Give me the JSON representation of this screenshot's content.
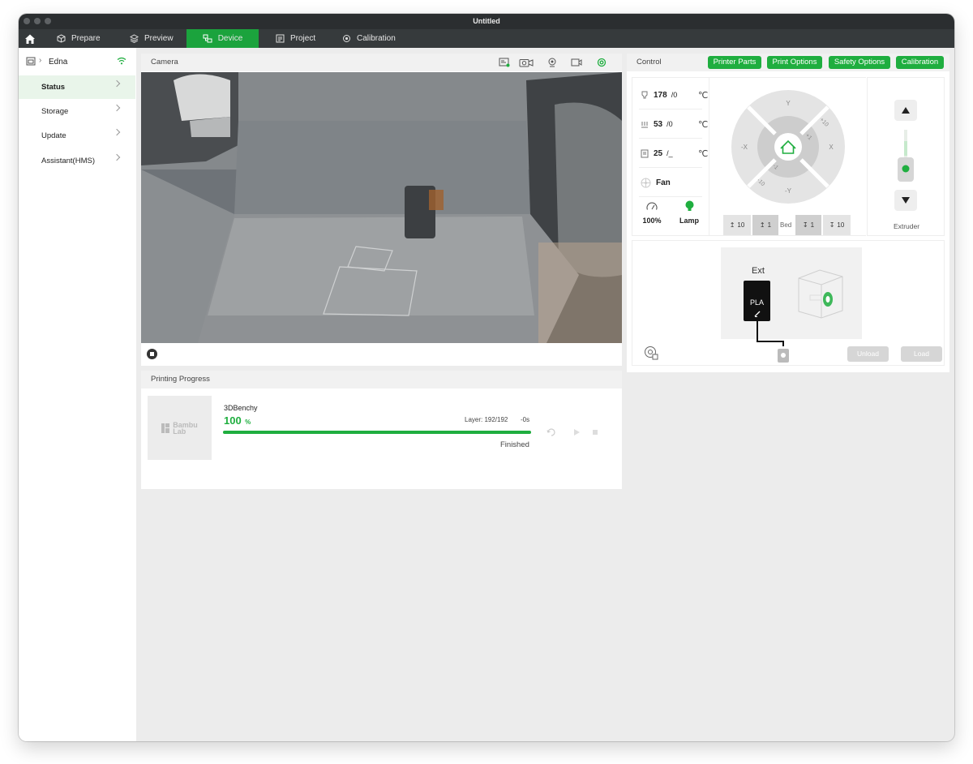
{
  "window": {
    "title": "Untitled"
  },
  "tabs": [
    {
      "label": "Prepare",
      "icon": "cube-icon"
    },
    {
      "label": "Preview",
      "icon": "layers-icon"
    },
    {
      "label": "Device",
      "icon": "device-icon",
      "active": true
    },
    {
      "label": "Project",
      "icon": "project-icon"
    },
    {
      "label": "Calibration",
      "icon": "calibration-icon"
    }
  ],
  "sidebar": {
    "device_name": "Edna",
    "items": [
      {
        "label": "Status",
        "active": true
      },
      {
        "label": "Storage"
      },
      {
        "label": "Update"
      },
      {
        "label": "Assistant(HMS)"
      }
    ]
  },
  "camera": {
    "title": "Camera",
    "icons": [
      "sd-card-icon",
      "camera-snapshot-icon",
      "webcam-icon",
      "video-record-icon",
      "settings-icon"
    ]
  },
  "progress": {
    "title": "Printing Progress",
    "thumbnail_logo_line1": "Bambu",
    "thumbnail_logo_line2": "Lab",
    "file_name": "3DBenchy",
    "percent": "100",
    "percent_unit": "%",
    "layer": "Layer: 192/192",
    "remaining": "-0s",
    "status": "Finished",
    "progress_fraction": 1.0
  },
  "control": {
    "title": "Control",
    "buttons": [
      "Printer Parts",
      "Print Options",
      "Safety Options",
      "Calibration"
    ],
    "nozzle_temp": "178",
    "nozzle_target": "/0",
    "bed_temp": "53",
    "bed_target": "/0",
    "chamber_temp": "25",
    "chamber_target": "/_",
    "temp_unit": "℃",
    "fan_label": "Fan",
    "speed_label": "100%",
    "lamp_label": "Lamp",
    "jog_labels": {
      "y_plus": "Y",
      "y_minus": "-Y",
      "x_plus": "X",
      "x_minus": "-X",
      "plus10": "+10",
      "plus1": "+1",
      "minus1": "-1",
      "minus10": "-10"
    },
    "bed_steps": [
      "10",
      "1",
      "Bed",
      "1",
      "10"
    ],
    "extruder_label": "Extruder"
  },
  "ams": {
    "ext_label": "Ext",
    "filament": "PLA",
    "unload_label": "Unload",
    "load_label": "Load"
  },
  "colors": {
    "accent": "#1fae3f",
    "titlebar": "#2b2e30",
    "tabbar": "#363a3c"
  }
}
